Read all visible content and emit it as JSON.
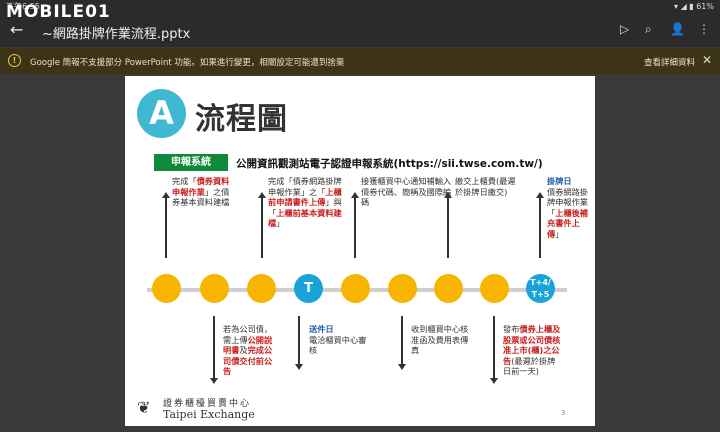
{
  "status": {
    "time": "下午6:55",
    "battery": "61%"
  },
  "watermark": "MOBILE01",
  "topbar": {
    "title": "~網路掛牌作業流程.pptx",
    "back_icon": "arrow-left-icon",
    "tools": [
      "play-icon",
      "search-icon",
      "add-person-icon",
      "more-vert-icon"
    ]
  },
  "banner": {
    "message": "Google 簡報不支援部分 PowerPoint 功能。如果進行變更，相關設定可能遭到捨棄",
    "details": "查看詳細資料",
    "close": "✕"
  },
  "slide": {
    "badge": "A",
    "heading": "流程圖",
    "system_label": "申報系統",
    "system_desc": "公開資訊觀測站電子認證申報系統(https://sii.twse.com.tw/)",
    "nodes": [
      "",
      "",
      "",
      "T",
      "",
      "",
      "",
      "",
      "T+4/\nT+5"
    ],
    "top_notes": [
      {
        "a": "完成「",
        "r": "債券資料申報作業",
        "b": "」之債券基本資料建檔"
      },
      {
        "a": "完成「債券網路掛牌申報作業」之「",
        "r": "上櫃前申請書件上傳",
        "c": "」與「",
        "r2": "上櫃前基本資料建檔",
        "d": "」"
      },
      {
        "a": "接獲櫃買中心通知補輸入債券代碼、簡稱及國際編碼"
      },
      {
        "a": "繳交上櫃費(最遲於掛牌日繳交)"
      },
      {
        "h": "掛牌日",
        "a": "債券網路掛牌申報作業「",
        "r": "上櫃後補充書件上傳",
        "d": "」"
      }
    ],
    "bottom_notes": [
      {
        "a": "若為公司債，需上傳",
        "r": "公開說明書",
        "b": "及",
        "r2": "完成公司債交付前公告"
      },
      {
        "h": "送件日",
        "a": "電洽櫃買中心審核"
      },
      {
        "a": "收到櫃買中心核准函及費用表傳真"
      },
      {
        "a": "發布",
        "r": "債券上櫃及股票或公司債核准上市(櫃)之公告",
        "d": "(最遲於掛牌日前一天)"
      }
    ],
    "logo_cn": "證券櫃檯買賣中心",
    "logo_en": "Taipei Exchange",
    "page_number": "3"
  },
  "colors": {
    "node_yellow": "#f7b500",
    "node_blue": "#1aa3d8",
    "badge": "#3fb9d1",
    "label_green": "#0f8a3a",
    "emph_red": "#cc1f1f"
  }
}
